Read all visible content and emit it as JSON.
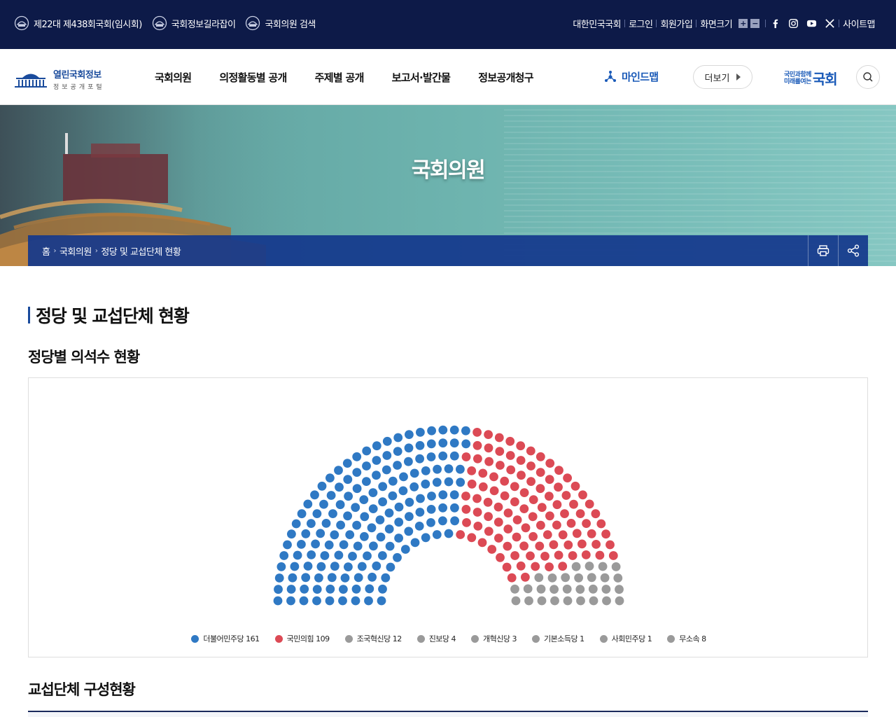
{
  "topbar": {
    "left_items": [
      {
        "label": "제22대 제438회국회(임시회)"
      },
      {
        "label": "국회정보길라잡이"
      },
      {
        "label": "국회의원 검색"
      }
    ],
    "links": {
      "assembly": "대한민국국회",
      "login": "로그인",
      "signup": "회원가입",
      "font_size": "화면크기",
      "zoom_in": "+",
      "zoom_out": "−",
      "sitemap": "사이트맵"
    }
  },
  "header": {
    "logo_title": "열린국회정보",
    "logo_subtitle": "정보공개포털",
    "nav": [
      "국회의원",
      "의정활동별 공개",
      "주제별 공개",
      "보고서·발간물",
      "정보공개청구"
    ],
    "mindmap": "마인드맵",
    "more": "더보기",
    "slogan_small_1": "국민과함께",
    "slogan_small_2": "미래를여는",
    "slogan_big": "국회"
  },
  "banner": {
    "title": "국회의원",
    "breadcrumb": [
      "홈",
      "국회의원",
      "정당 및 교섭단체 현황"
    ]
  },
  "content": {
    "page_title": "정당 및 교섭단체 현황",
    "section_seats": "정당별 의석수 현황",
    "section_groups": "교섭단체 구성현황"
  },
  "colors": {
    "blue": "#2f79c4",
    "red": "#dc4a55",
    "gray": "#9a9a9a",
    "navy": "#0d1a48"
  },
  "chart_data": {
    "type": "parliament",
    "total_seats": 299,
    "parties": [
      {
        "name": "더불어민주당",
        "seats": 161,
        "color": "#2f79c4",
        "legend": "더불어민주당 161"
      },
      {
        "name": "국민의힘",
        "seats": 109,
        "color": "#dc4a55",
        "legend": "국민의힘 109"
      },
      {
        "name": "조국혁신당",
        "seats": 12,
        "color": "#9a9a9a",
        "legend": "조국혁신당 12"
      },
      {
        "name": "진보당",
        "seats": 4,
        "color": "#9a9a9a",
        "legend": "진보당 4"
      },
      {
        "name": "개혁신당",
        "seats": 3,
        "color": "#9a9a9a",
        "legend": "개혁신당 3"
      },
      {
        "name": "기본소득당",
        "seats": 1,
        "color": "#9a9a9a",
        "legend": "기본소득당 1"
      },
      {
        "name": "사회민주당",
        "seats": 1,
        "color": "#9a9a9a",
        "legend": "사회민주당 1"
      },
      {
        "name": "무소속",
        "seats": 8,
        "color": "#9a9a9a",
        "legend": "무소속 8"
      }
    ]
  }
}
